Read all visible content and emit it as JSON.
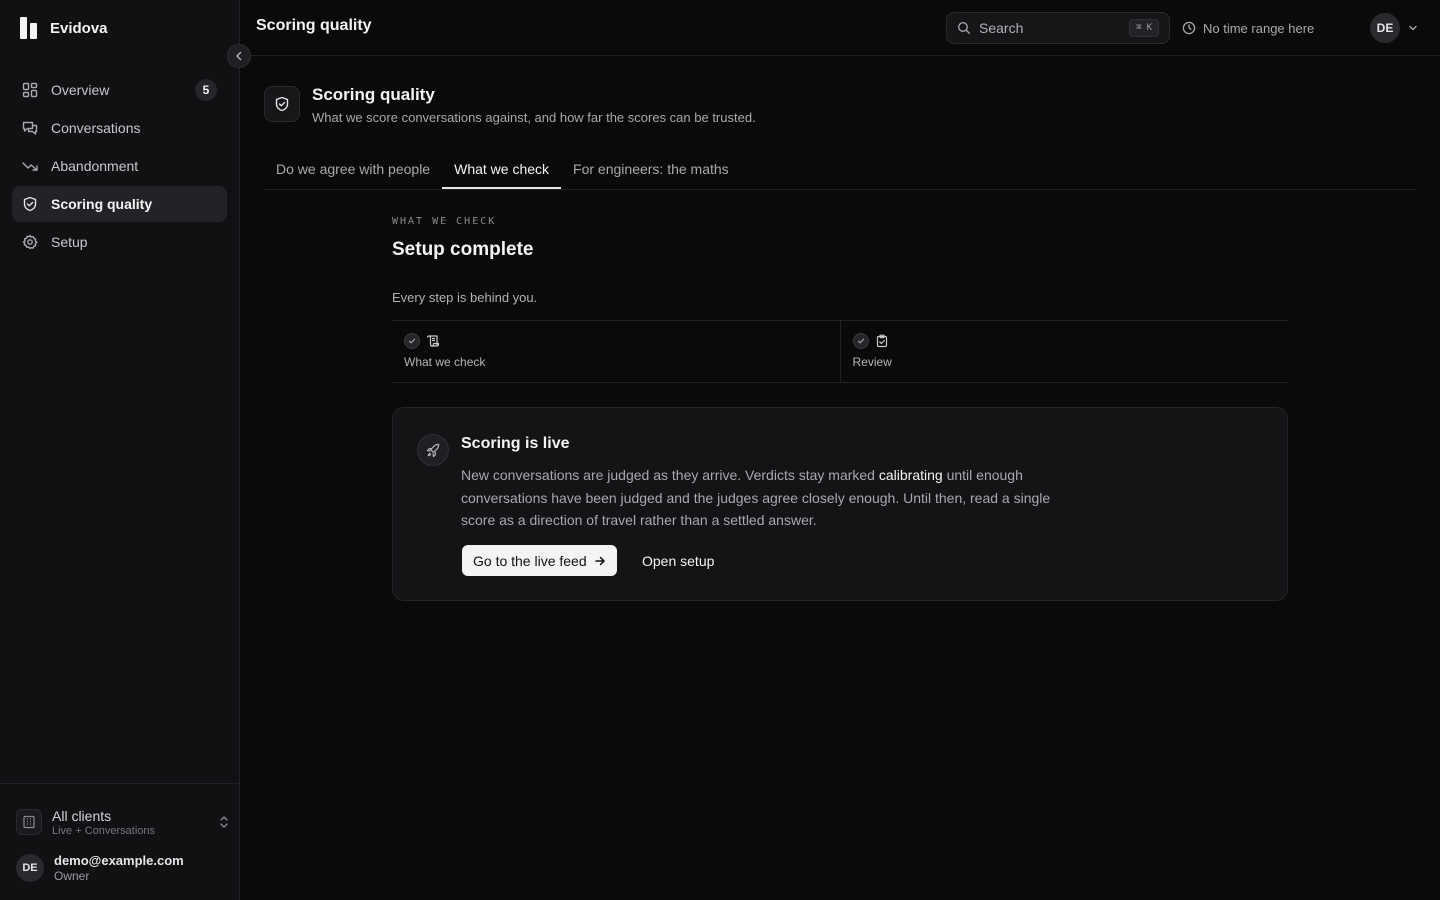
{
  "brand": {
    "name": "Evidova"
  },
  "sidebar": {
    "items": [
      {
        "label": "Overview",
        "badge": "5",
        "icon": "grid-icon"
      },
      {
        "label": "Conversations",
        "icon": "chat-icon"
      },
      {
        "label": "Abandonment",
        "icon": "trend-down-icon"
      },
      {
        "label": "Scoring quality",
        "icon": "shield-check-icon",
        "active": true
      },
      {
        "label": "Setup",
        "icon": "gear-icon"
      }
    ],
    "client": {
      "title": "All clients",
      "subtitle": "Live + Conversations"
    },
    "user": {
      "initials": "DE",
      "email": "demo@example.com",
      "role": "Owner"
    }
  },
  "topbar": {
    "title": "Scoring quality",
    "search_placeholder": "Search",
    "shortcut_mod": "⌘",
    "shortcut_key": "K",
    "time_range": "No time range here",
    "avatar_initials": "DE"
  },
  "page": {
    "title": "Scoring quality",
    "subtitle": "What we score conversations against, and how far the scores can be trusted."
  },
  "tabs": [
    {
      "label": "Do we agree with people"
    },
    {
      "label": "What we check",
      "active": true
    },
    {
      "label": "For engineers: the maths"
    }
  ],
  "section": {
    "eyebrow": "WHAT WE CHECK",
    "title": "Setup complete",
    "description": "Every step is behind you.",
    "steps": [
      {
        "label": "What we check",
        "icon": "scroll-icon",
        "done": true
      },
      {
        "label": "Review",
        "icon": "clipboard-check-icon",
        "done": true
      }
    ]
  },
  "live_card": {
    "title": "Scoring is live",
    "body_before": "New conversations are judged as they arrive. Verdicts stay marked ",
    "body_highlight": "calibrating",
    "body_after": " until enough conversations have been judged and the judges agree closely enough. Until then, read a single score as a direction of travel rather than a settled answer.",
    "primary_button": "Go to the live feed",
    "secondary_button": "Open setup"
  },
  "colors": {
    "background": "#0a0a0b",
    "sidebar": "#111113",
    "active_item": "#232327",
    "primary_button": "#f4f4f5"
  }
}
